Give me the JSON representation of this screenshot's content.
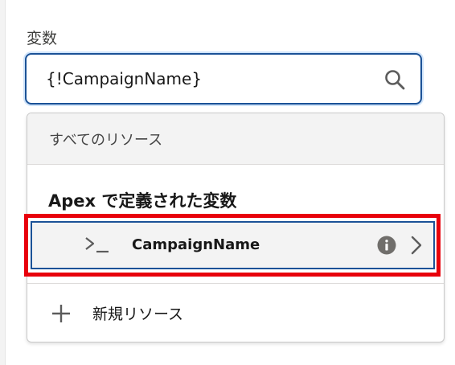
{
  "field": {
    "label": "変数",
    "value": "{!CampaignName}"
  },
  "dropdown": {
    "section_header": "すべてのリソース",
    "group_title": "Apex で定義された変数",
    "options": [
      {
        "label": "CampaignName",
        "icon": "variable-icon"
      }
    ],
    "new_resource_label": "新規リソース"
  },
  "colors": {
    "focus_border": "#1b5297",
    "highlight": "#e8000b",
    "header_bg": "#f3f3f3"
  }
}
